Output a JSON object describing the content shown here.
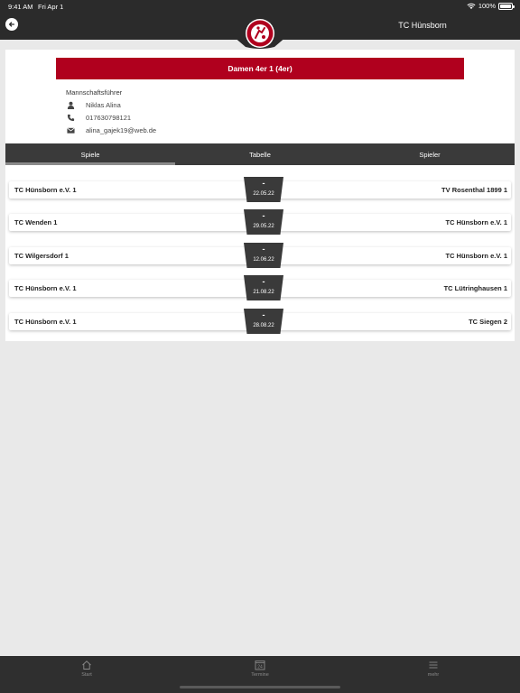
{
  "status": {
    "time": "9:41 AM",
    "date": "Fri Apr 1",
    "battery": "100%"
  },
  "header": {
    "title": "TC Hünsborn",
    "logo_icon": "tennis-club-logo"
  },
  "team": {
    "name": "Damen 4er 1 (4er)"
  },
  "captain": {
    "label": "Mannschaftsführer",
    "name": "Niklas Alina",
    "phone": "017630798121",
    "email": "alina_gajek19@web.de"
  },
  "tabs": [
    {
      "label": "Spiele",
      "active": true
    },
    {
      "label": "Tabelle",
      "active": false
    },
    {
      "label": "Spieler",
      "active": false
    }
  ],
  "matches": [
    {
      "home": "TC Hünsborn e.V. 1",
      "away": "TV Rosenthal 1899 1",
      "score": "-",
      "date": "22.05.22"
    },
    {
      "home": "TC Wenden 1",
      "away": "TC Hünsborn e.V. 1",
      "score": "-",
      "date": "29.05.22"
    },
    {
      "home": "TC Wilgersdorf 1",
      "away": "TC Hünsborn e.V. 1",
      "score": "-",
      "date": "12.06.22"
    },
    {
      "home": "TC Hünsborn e.V. 1",
      "away": "TC Lütringhausen 1",
      "score": "-",
      "date": "21.08.22"
    },
    {
      "home": "TC Hünsborn e.V. 1",
      "away": "TC Siegen 2",
      "score": "-",
      "date": "28.08.22"
    }
  ],
  "bottom_nav": [
    {
      "label": "Start",
      "icon": "home-icon"
    },
    {
      "label": "Termine",
      "icon": "calendar-icon",
      "badge": "24"
    },
    {
      "label": "mehr",
      "icon": "menu-icon"
    }
  ],
  "colors": {
    "accent": "#b0001e",
    "bar": "#2b2b2b",
    "tab_bar": "#3a3a3a"
  }
}
